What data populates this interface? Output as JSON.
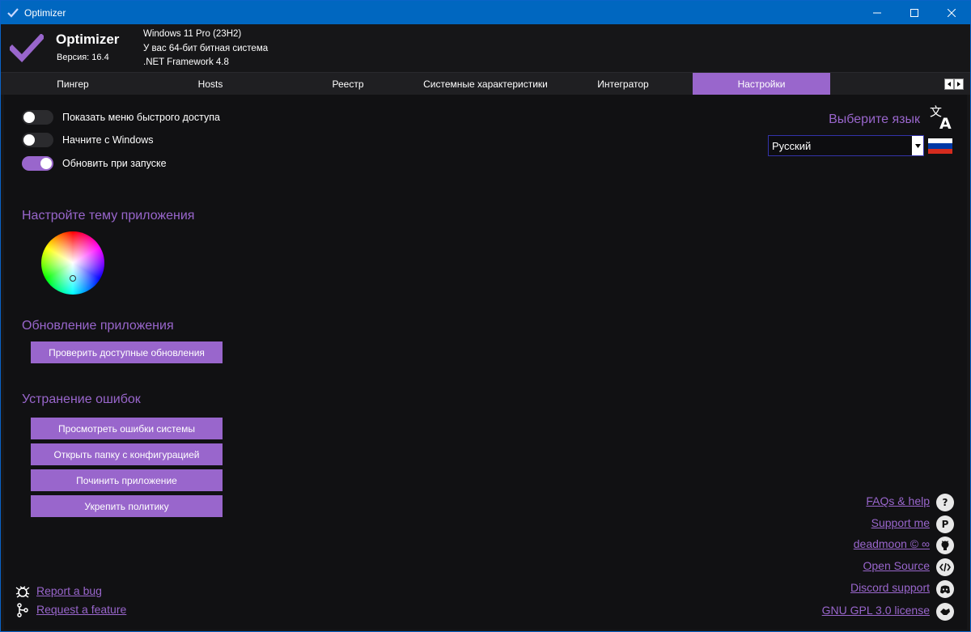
{
  "window": {
    "title": "Optimizer"
  },
  "header": {
    "app_name": "Optimizer",
    "version": "Версия: 16.4",
    "os": "Windows 11 Pro (23H2)",
    "bitness": "У вас 64-бит битная система",
    "framework": ".NET Framework 4.8"
  },
  "tabs": [
    {
      "label": "Пингер",
      "active": false
    },
    {
      "label": "Hosts",
      "active": false
    },
    {
      "label": "Реестр",
      "active": false
    },
    {
      "label": "Системные характеристики",
      "active": false
    },
    {
      "label": "Интегратор",
      "active": false
    },
    {
      "label": "Настройки",
      "active": true
    }
  ],
  "toggles": [
    {
      "label": "Показать меню быстрого доступа",
      "on": false
    },
    {
      "label": "Начните с Windows",
      "on": false
    },
    {
      "label": "Обновить при запуске",
      "on": true
    }
  ],
  "theme": {
    "title": "Настройте тему приложения"
  },
  "update": {
    "title": "Обновление приложения",
    "check_button": "Проверить доступные обновления"
  },
  "troubleshoot": {
    "title": "Устранение ошибок",
    "buttons": [
      "Просмотреть ошибки системы",
      "Открыть папку с конфигурацией",
      "Починить приложение",
      "Укрепить политику"
    ]
  },
  "language": {
    "title": "Выберите язык",
    "selected": "Русский"
  },
  "links_right": [
    {
      "label": "FAQs & help",
      "icon": "question-icon"
    },
    {
      "label": "Support me",
      "icon": "paypal-icon"
    },
    {
      "label": "deadmoon © ∞",
      "icon": "github-icon"
    },
    {
      "label": "Open Source",
      "icon": "code-icon"
    },
    {
      "label": "Discord support",
      "icon": "discord-icon"
    },
    {
      "label": "GNU GPL 3.0 license",
      "icon": "license-icon"
    }
  ],
  "links_left": [
    {
      "label": "Report a bug",
      "icon": "bug-icon"
    },
    {
      "label": "Request a feature",
      "icon": "feature-icon"
    }
  ],
  "colors": {
    "accent": "#9966cc",
    "titlebar": "#0067c0",
    "background": "#111113"
  }
}
